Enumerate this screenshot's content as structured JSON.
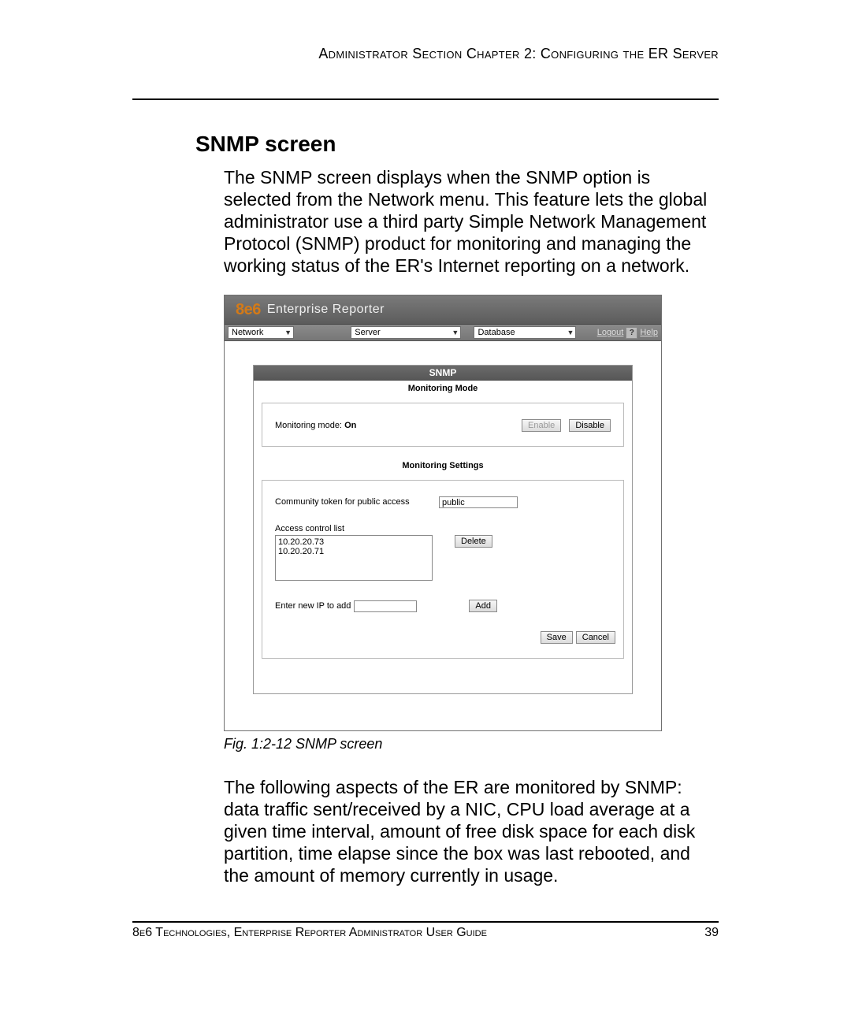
{
  "header": {
    "right_text": "Administrator Section  Chapter 2: Configuring the ER Server"
  },
  "section_title": "SNMP screen",
  "intro_text": "The SNMP screen displays when the SNMP option is selected from the Network menu. This feature lets the global administrator use a third party Simple Network Management Protocol (SNMP) product for monitoring and managing the working status of the ER's Internet reporting on a network.",
  "figure": {
    "caption": "Fig. 1:2-12  SNMP screen"
  },
  "screenshot": {
    "logo_brand": "8e6",
    "logo_text": "Enterprise Reporter",
    "menus": {
      "network": "Network",
      "server": "Server",
      "database": "Database"
    },
    "links": {
      "logout": "Logout",
      "help": "Help"
    },
    "panel": {
      "title": "SNMP",
      "monitoring_mode": {
        "heading": "Monitoring Mode",
        "label": "Monitoring mode:",
        "value": "On",
        "enable": "Enable",
        "disable": "Disable"
      },
      "monitoring_settings": {
        "heading": "Monitoring Settings",
        "community_label": "Community token for public access",
        "community_value": "public",
        "acl_label": "Access control list",
        "acl_items": [
          "10.20.20.73",
          "10.20.20.71"
        ],
        "delete": "Delete",
        "new_ip_label": "Enter new IP to add",
        "new_ip_value": "",
        "add": "Add",
        "save": "Save",
        "cancel": "Cancel"
      }
    }
  },
  "after_text": "The following aspects of the ER are monitored by SNMP: data traffic sent/received by a NIC, CPU load average at a given time interval, amount of free disk space for each disk partition, time elapse since the box was last rebooted, and the amount of memory currently in usage.",
  "footer": {
    "left": "8e6 Technologies, Enterprise Reporter Administrator User Guide",
    "right": "39"
  }
}
